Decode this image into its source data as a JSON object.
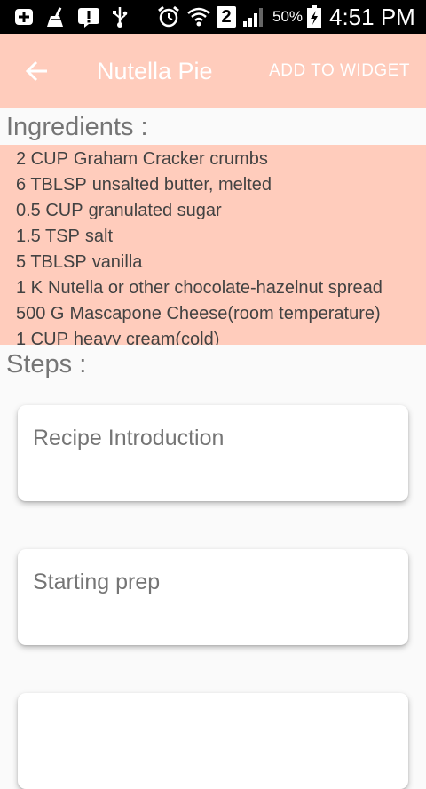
{
  "status_bar": {
    "battery_percent": "50%",
    "time": "4:51 PM",
    "sim_slot": "2"
  },
  "toolbar": {
    "title": "Nutella Pie",
    "add_widget_label": "ADD TO WIDGET"
  },
  "ingredients": {
    "label": "Ingredients :",
    "items": [
      {
        "qty": "2 CUP",
        "name": "Graham Cracker crumbs"
      },
      {
        "qty": "6 TBLSP",
        "name": "unsalted butter, melted"
      },
      {
        "qty": "0.5 CUP",
        "name": "granulated sugar"
      },
      {
        "qty": "1.5 TSP",
        "name": "salt"
      },
      {
        "qty": "5 TBLSP",
        "name": "vanilla"
      },
      {
        "qty": "1 K",
        "name": "Nutella or other chocolate-hazelnut spread"
      },
      {
        "qty": "500 G",
        "name": "Mascapone Cheese(room temperature)"
      },
      {
        "qty": "1 CUP",
        "name": "heavy cream(cold)"
      }
    ]
  },
  "steps": {
    "label": "Steps :",
    "items": [
      {
        "title": "Recipe Introduction"
      },
      {
        "title": "Starting prep"
      },
      {
        "title": ""
      }
    ]
  },
  "colors": {
    "accent": "#ffccbc",
    "status_bar": "#000000"
  }
}
